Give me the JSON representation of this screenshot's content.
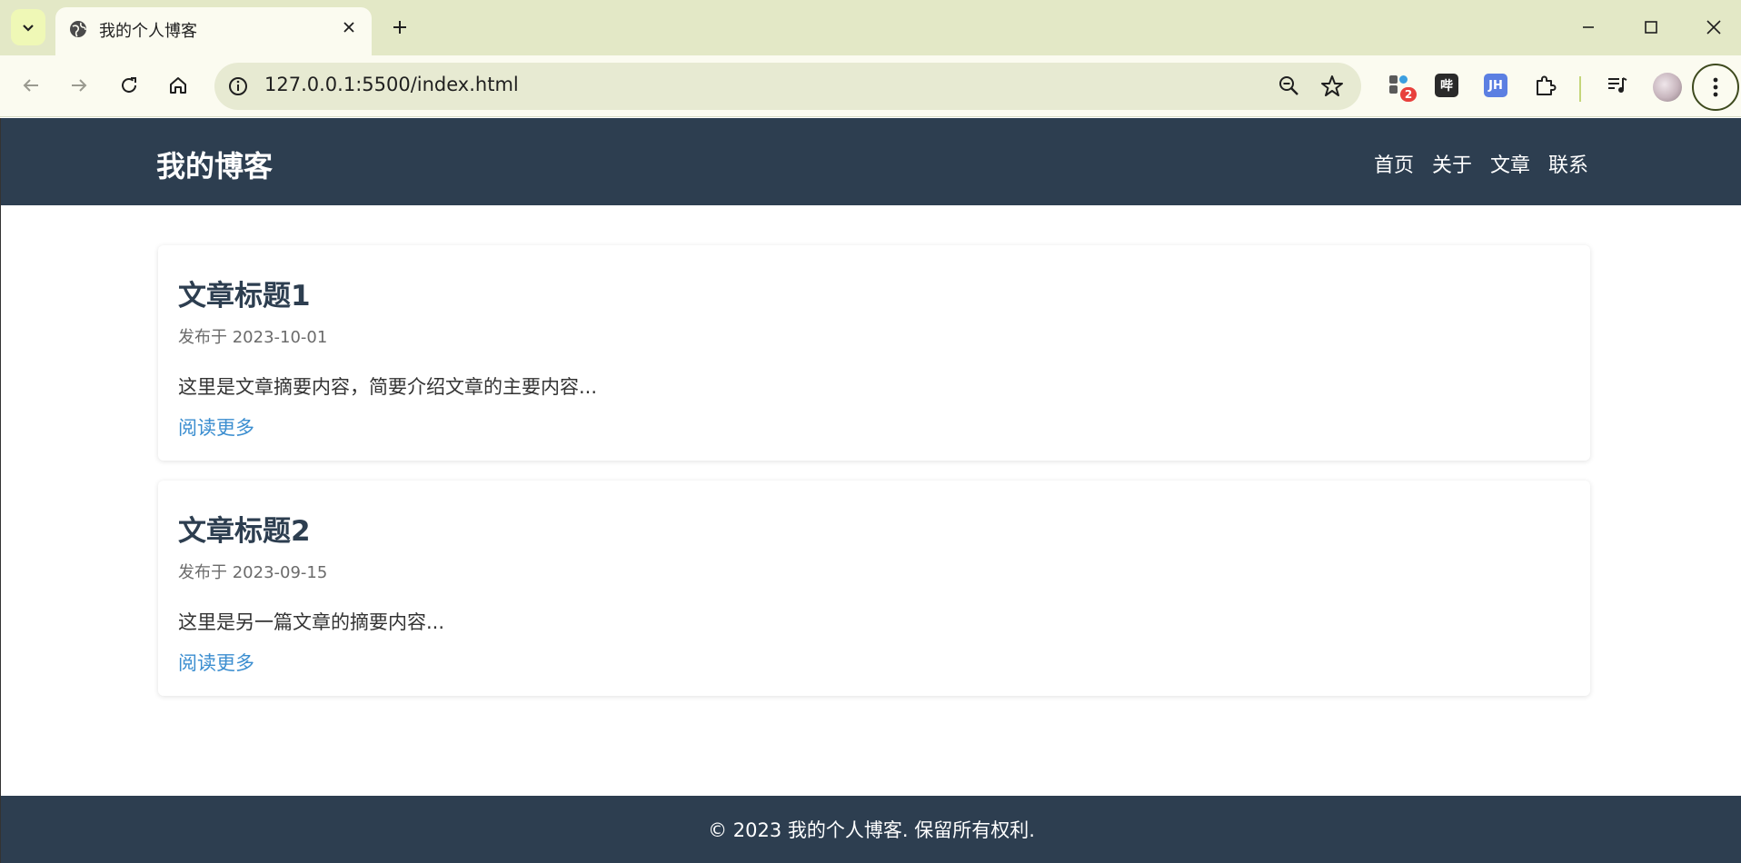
{
  "browser": {
    "tab_title": "我的个人博客",
    "url": "127.0.0.1:5500/index.html",
    "extension_badge": "2",
    "ext_bili_label": "哔",
    "ext_jh_label": "JH"
  },
  "header": {
    "logo": "我的博客",
    "nav": [
      "首页",
      "关于",
      "文章",
      "联系"
    ]
  },
  "posts": [
    {
      "title": "文章标题1",
      "meta": "发布于 2023-10-01",
      "excerpt": "这里是文章摘要内容，简要介绍文章的主要内容...",
      "more": "阅读更多"
    },
    {
      "title": "文章标题2",
      "meta": "发布于 2023-09-15",
      "excerpt": "这里是另一篇文章的摘要内容...",
      "more": "阅读更多"
    }
  ],
  "footer": {
    "copyright": "© 2023 我的个人博客. 保留所有权利."
  },
  "colors": {
    "header_bg": "#2d3e50",
    "link": "#3b8ed0",
    "title": "#2d3e50"
  }
}
